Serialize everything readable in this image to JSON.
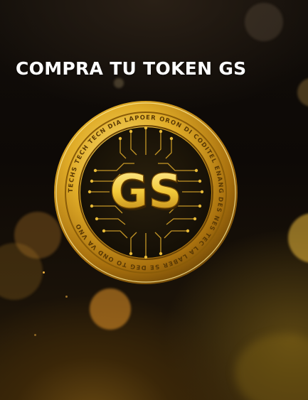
{
  "banner": {
    "title": "COMPRA TU TOKEN GS"
  },
  "coin": {
    "icon": "gs-token-coin-icon",
    "monogram": "GS",
    "rim_text": "TECHS TECH TECN DIA LAPOER ORON DI CODITEL ENANG DES NES TEC LA LABER SE DEG TO OND VA VNO"
  },
  "colors": {
    "gold_light": "#f7dc6a",
    "gold": "#d9a524",
    "gold_dark": "#8a5c08",
    "background": "#0d0906",
    "title_text": "#ffffff"
  }
}
